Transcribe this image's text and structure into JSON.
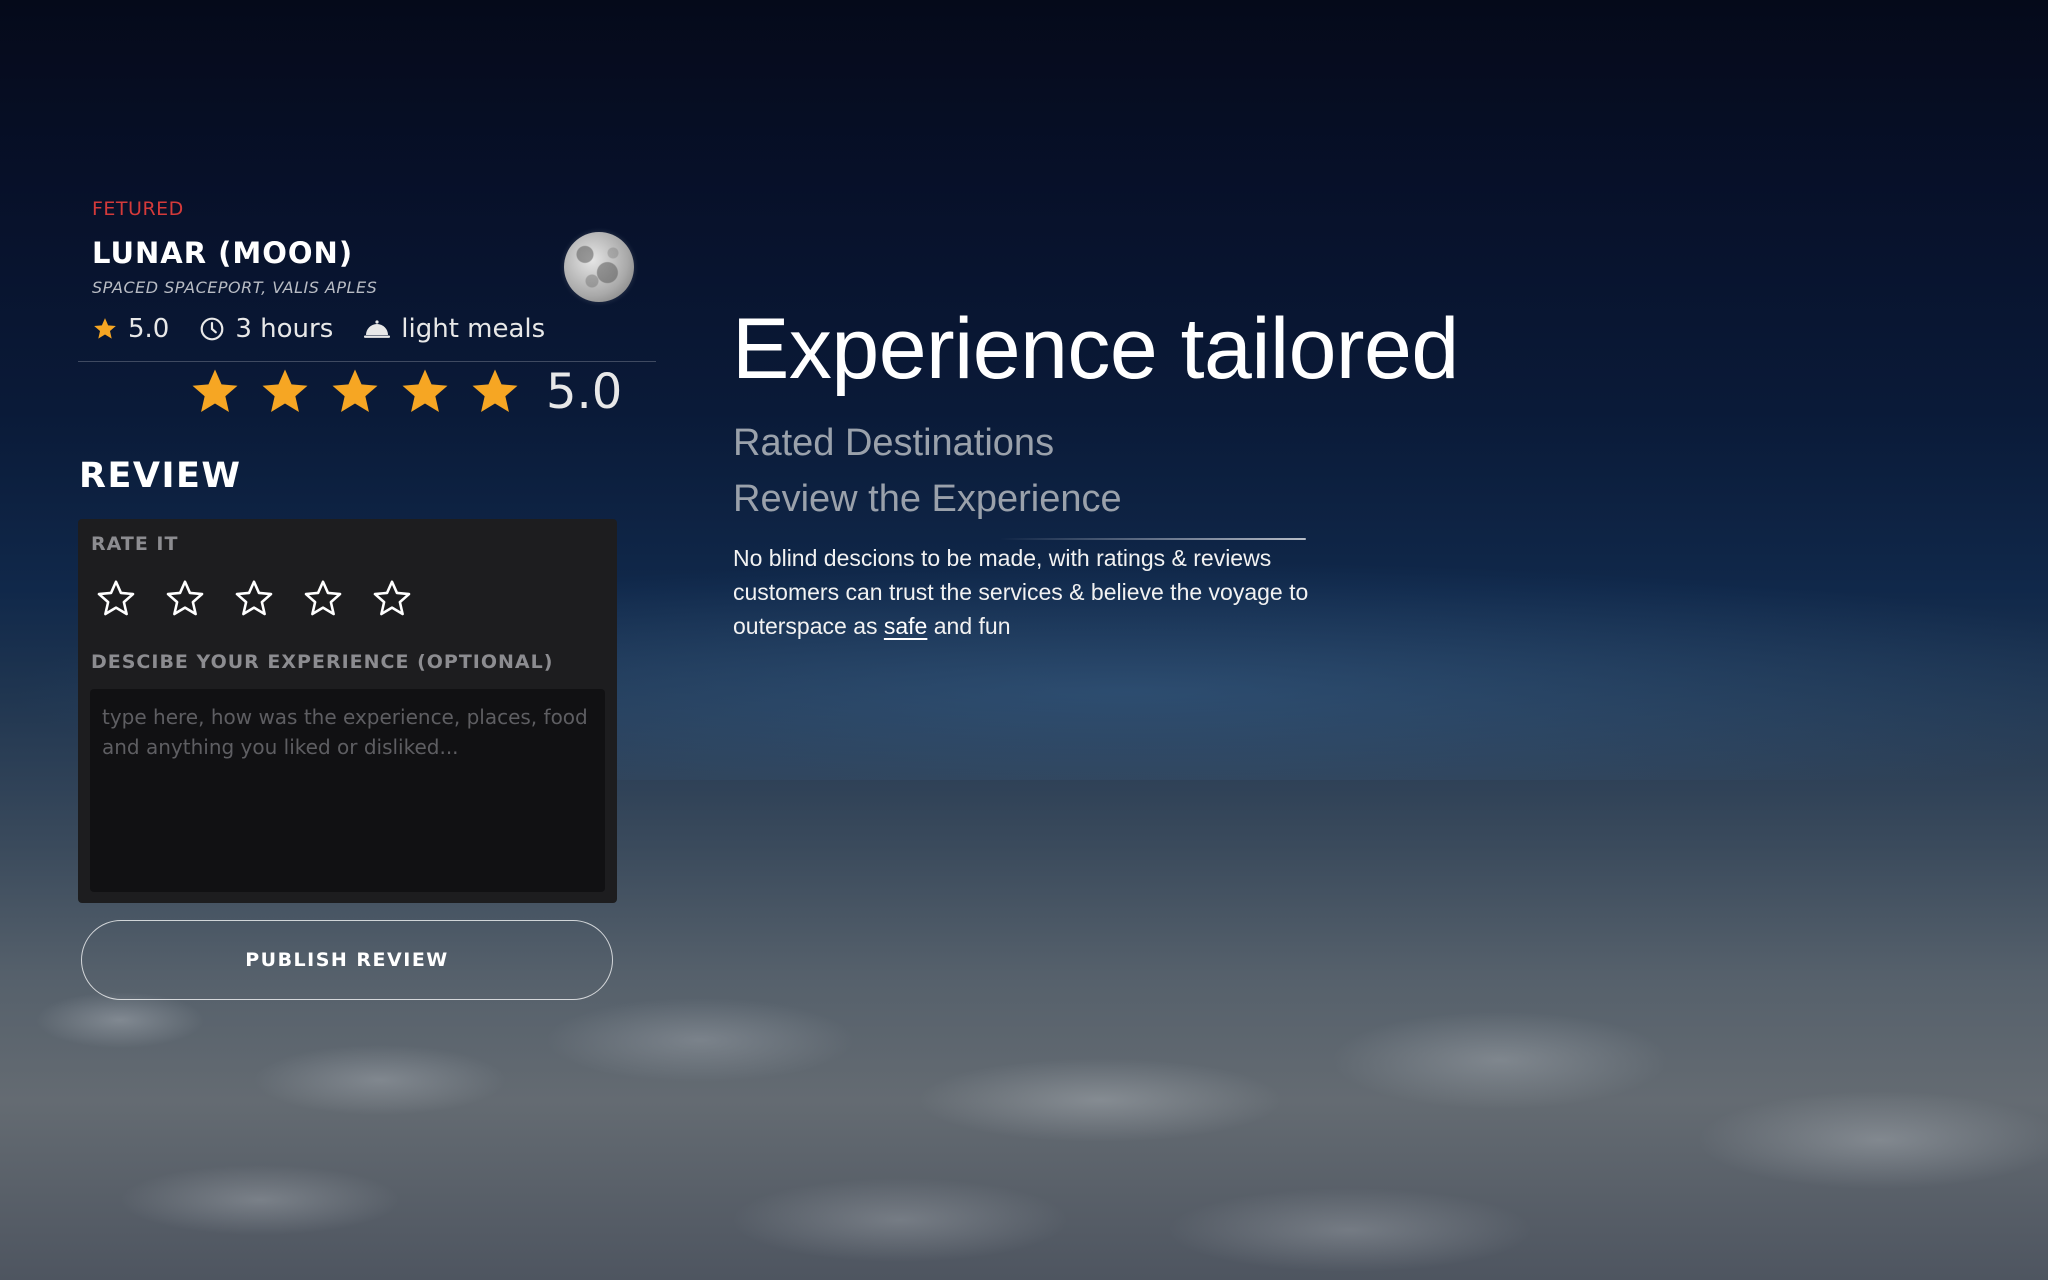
{
  "featured": {
    "tag": "FETURED",
    "title": "LUNAR (MOON)",
    "subtitle": "SPACED SPACEPORT, VALIS APLES",
    "meta": {
      "rating": "5.0",
      "duration": "3 hours",
      "meals": "light meals"
    },
    "overall_rating": {
      "stars": 5,
      "max_stars": 5,
      "value": "5.0"
    }
  },
  "review": {
    "heading": "REVIEW",
    "rate_label": "RATE IT",
    "selected_stars": 0,
    "max_stars": 5,
    "description_label": "DESCIBE YOUR EXPERIENCE (OPTIONAL)",
    "description_placeholder": "type here, how was the experience, places, food and anything you liked or disliked...",
    "description_value": "",
    "publish_label": "PUBLISH REVIEW"
  },
  "hero": {
    "title": "Experience tailored",
    "line1": "Rated Destinations",
    "line2": "Review the Experience",
    "body_before": "No blind descions to be made, with ratings & reviews customers can trust the services & believe the voyage to outerspace as ",
    "body_link": "safe",
    "body_after": " and fun"
  },
  "colors": {
    "accent_red": "#d43a3a",
    "star_gold": "#f6a623",
    "card_bg": "#1d1d1f",
    "input_bg": "#111113"
  },
  "icons": {
    "rating": "star-icon",
    "duration": "clock-icon",
    "meals": "cloche-icon",
    "destination": "moon-icon"
  }
}
